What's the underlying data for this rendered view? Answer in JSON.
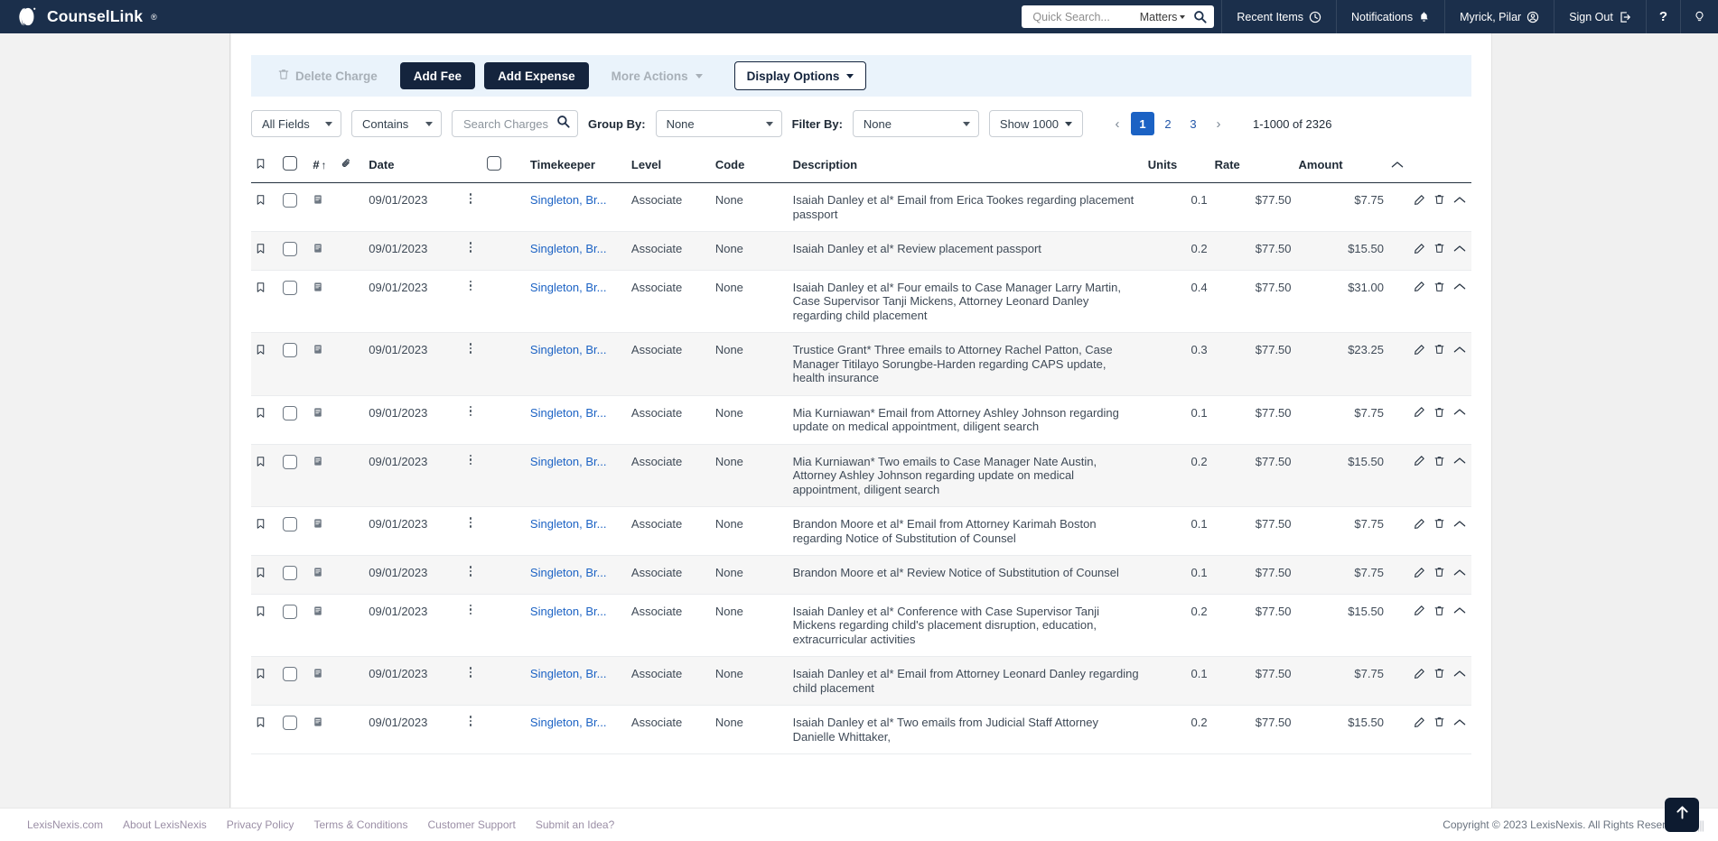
{
  "topnav": {
    "brand": "CounselLink",
    "brand_tm": "®",
    "quick_search": {
      "placeholder": "Quick Search...",
      "value": "",
      "scope": "Matters",
      "search_icon": "magnifier-icon"
    },
    "items": [
      {
        "label": "Recent Items",
        "icon": "clock-icon"
      },
      {
        "label": "Notifications",
        "icon": "bell-icon"
      },
      {
        "label": "Myrick, Pilar",
        "icon": "user-circle-icon"
      },
      {
        "label": "Sign Out",
        "icon": "sign-out-icon"
      },
      {
        "label": "?",
        "icon": "help-icon"
      },
      {
        "label": "",
        "icon": "lightbulb-icon"
      }
    ]
  },
  "actionbar": {
    "delete_charge": "Delete Charge",
    "add_fee": "Add Fee",
    "add_expense": "Add Expense",
    "more_actions": "More Actions",
    "display_options": "Display Options"
  },
  "filterbar": {
    "field_select": "All Fields",
    "operator_select": "Contains",
    "search_placeholder": "Search Charges",
    "search_value": "",
    "group_by_label": "Group By:",
    "group_by_value": "None",
    "filter_by_label": "Filter By:",
    "filter_by_value": "None",
    "show_count": "Show 1000",
    "pagination": {
      "prev": "‹",
      "next": "›",
      "pages": [
        "1",
        "2",
        "3"
      ],
      "active_page": "1",
      "range_text": "1-1000 of 2326"
    }
  },
  "table": {
    "headers": {
      "flag": "bookmark-icon",
      "select_all": "select-all-checkbox",
      "number": "#",
      "sort": "↑",
      "attachment": "paperclip-icon",
      "date": "Date",
      "select_all_2": "select-all-checkbox-2",
      "timekeeper": "Timekeeper",
      "level": "Level",
      "code": "Code",
      "description": "Description",
      "units": "Units",
      "rate": "Rate",
      "amount": "Amount",
      "collapse": "chevron-up-icon"
    },
    "rows": [
      {
        "date": "09/01/2023",
        "timekeeper": "Singleton, Br...",
        "level": "Associate",
        "code": "None",
        "description": "Isaiah Danley et al* Email from Erica Tookes regarding placement passport",
        "units": "0.1",
        "rate": "$77.50",
        "amount": "$7.75"
      },
      {
        "date": "09/01/2023",
        "timekeeper": "Singleton, Br...",
        "level": "Associate",
        "code": "None",
        "description": "Isaiah Danley et al* Review placement passport",
        "units": "0.2",
        "rate": "$77.50",
        "amount": "$15.50"
      },
      {
        "date": "09/01/2023",
        "timekeeper": "Singleton, Br...",
        "level": "Associate",
        "code": "None",
        "description": "Isaiah Danley et al* Four emails to Case Manager Larry Martin, Case Supervisor Tanji Mickens, Attorney Leonard Danley regarding child placement",
        "units": "0.4",
        "rate": "$77.50",
        "amount": "$31.00"
      },
      {
        "date": "09/01/2023",
        "timekeeper": "Singleton, Br...",
        "level": "Associate",
        "code": "None",
        "description": "Trustice Grant* Three emails to Attorney Rachel Patton, Case Manager Titilayo Sorungbe-Harden regarding CAPS update, health insurance",
        "units": "0.3",
        "rate": "$77.50",
        "amount": "$23.25"
      },
      {
        "date": "09/01/2023",
        "timekeeper": "Singleton, Br...",
        "level": "Associate",
        "code": "None",
        "description": "Mia Kurniawan* Email from Attorney Ashley Johnson regarding update on medical appointment, diligent search",
        "units": "0.1",
        "rate": "$77.50",
        "amount": "$7.75"
      },
      {
        "date": "09/01/2023",
        "timekeeper": "Singleton, Br...",
        "level": "Associate",
        "code": "None",
        "description": "Mia Kurniawan* Two emails to Case Manager Nate Austin, Attorney Ashley Johnson regarding update on medical appointment, diligent search",
        "units": "0.2",
        "rate": "$77.50",
        "amount": "$15.50"
      },
      {
        "date": "09/01/2023",
        "timekeeper": "Singleton, Br...",
        "level": "Associate",
        "code": "None",
        "description": "Brandon Moore et al* Email from Attorney Karimah Boston regarding Notice of Substitution of Counsel",
        "units": "0.1",
        "rate": "$77.50",
        "amount": "$7.75"
      },
      {
        "date": "09/01/2023",
        "timekeeper": "Singleton, Br...",
        "level": "Associate",
        "code": "None",
        "description": "Brandon Moore et al* Review Notice of Substitution of Counsel",
        "units": "0.1",
        "rate": "$77.50",
        "amount": "$7.75"
      },
      {
        "date": "09/01/2023",
        "timekeeper": "Singleton, Br...",
        "level": "Associate",
        "code": "None",
        "description": "Isaiah Danley et al* Conference with Case Supervisor Tanji Mickens regarding child's placement disruption, education, extracurricular activities",
        "units": "0.2",
        "rate": "$77.50",
        "amount": "$15.50"
      },
      {
        "date": "09/01/2023",
        "timekeeper": "Singleton, Br...",
        "level": "Associate",
        "code": "None",
        "description": "Isaiah Danley et al* Email from Attorney Leonard Danley regarding child placement",
        "units": "0.1",
        "rate": "$77.50",
        "amount": "$7.75"
      },
      {
        "date": "09/01/2023",
        "timekeeper": "Singleton, Br...",
        "level": "Associate",
        "code": "None",
        "description": "Isaiah Danley et al* Two emails from Judicial Staff Attorney Danielle Whittaker,",
        "units": "0.2",
        "rate": "$77.50",
        "amount": "$15.50"
      }
    ]
  },
  "footer": {
    "links": [
      "LexisNexis.com",
      "About LexisNexis",
      "Privacy Policy",
      "Terms & Conditions",
      "Customer Support",
      "Submit an Idea?"
    ],
    "copyright": "Copyright © 2023 LexisNexis. All Rights Reserved."
  },
  "fab": {
    "icon": "arrow-up-icon"
  },
  "colors": {
    "nav_bg": "#1b2f4b",
    "primary_btn": "#14243d",
    "link": "#1b62c4",
    "actionbar_bg": "#eaf3fb",
    "active_page": "#1b62c4"
  }
}
